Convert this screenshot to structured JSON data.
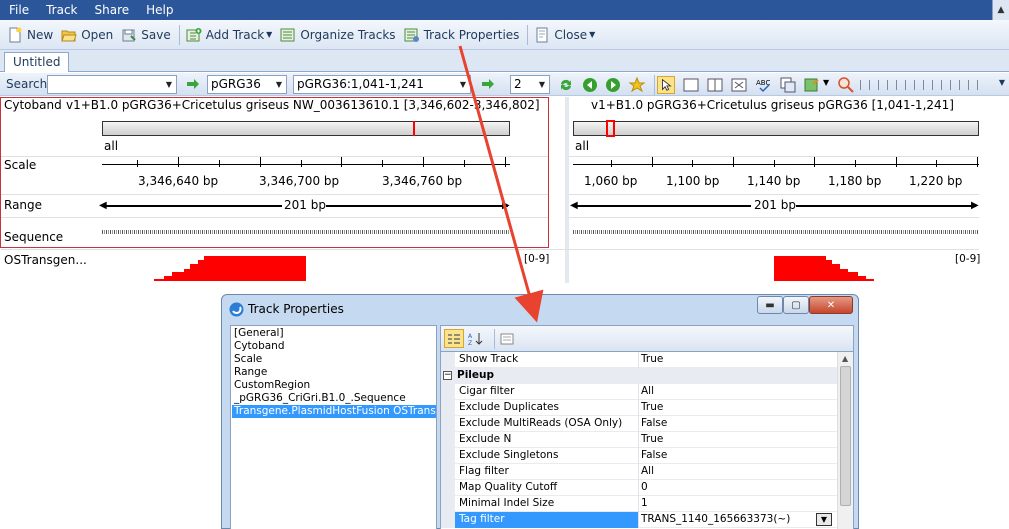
{
  "menu": [
    "File",
    "Track",
    "Share",
    "Help"
  ],
  "toolbar": {
    "new_label": "New",
    "open_label": "Open",
    "save_label": "Save",
    "add_track_label": "Add Track",
    "organize_label": "Organize Tracks",
    "properties_label": "Track Properties",
    "close_label": "Close"
  },
  "doc_tab": "Untitled",
  "searchbar": {
    "search_label": "Search",
    "search_value": "",
    "genome_value": "pGRG36",
    "location_value": "pGRG36:1,041-1,241",
    "count_value": "2"
  },
  "left_view": {
    "cytoband_label": "Cytoband",
    "header": "v1+B1.0  pGRG36+Cricetulus  griseus  NW_003613610.1  [3,346,602-3,346,802]",
    "all_label": "all",
    "scale_label": "Scale",
    "scale_ticks": [
      "3,346,640 bp",
      "3,346,700 bp",
      "3,346,760 bp"
    ],
    "range_label": "Range",
    "range_text": "201 bp",
    "sequence_label": "Sequence",
    "os_label": "OSTransgen...",
    "os_range": "[0-9]"
  },
  "right_view": {
    "header": "v1+B1.0  pGRG36+Cricetulus  griseus  pGRG36  [1,041-1,241]",
    "all_label": "all",
    "scale_ticks": [
      "1,060 bp",
      "1,100 bp",
      "1,140 bp",
      "1,180 bp",
      "1,220 bp"
    ],
    "range_text": "201 bp",
    "os_range": "[0-9]"
  },
  "dialog": {
    "title": "Track Properties",
    "tracks": [
      "[General]",
      "Cytoband",
      "Scale",
      "Range",
      "CustomRegion",
      "_pGRG36_CriGri.B1.0_.Sequence",
      "Transgene.PlasmidHostFusion OSTransgen"
    ],
    "selected_track_index": 6,
    "properties": [
      {
        "name": "Show Track",
        "value": "True"
      },
      {
        "name": "Pileup",
        "value": "",
        "category": true
      },
      {
        "name": "Cigar filter",
        "value": "All"
      },
      {
        "name": "Exclude Duplicates",
        "value": "True"
      },
      {
        "name": "Exclude MultiReads (OSA Only)",
        "value": "False"
      },
      {
        "name": "Exclude N",
        "value": "True"
      },
      {
        "name": "Exclude Singletons",
        "value": "False"
      },
      {
        "name": "Flag filter",
        "value": "All"
      },
      {
        "name": "Map Quality Cutoff",
        "value": "0"
      },
      {
        "name": "Minimal Indel Size",
        "value": "1"
      },
      {
        "name": "Tag filter",
        "value": "TRANS_1140_165663373(~)",
        "selected": true
      }
    ]
  },
  "colors": {
    "menubar": "#2b579a",
    "highlight": "#3399ff",
    "pileup": "#ff0000",
    "annotation_arrow": "#e8432f"
  }
}
